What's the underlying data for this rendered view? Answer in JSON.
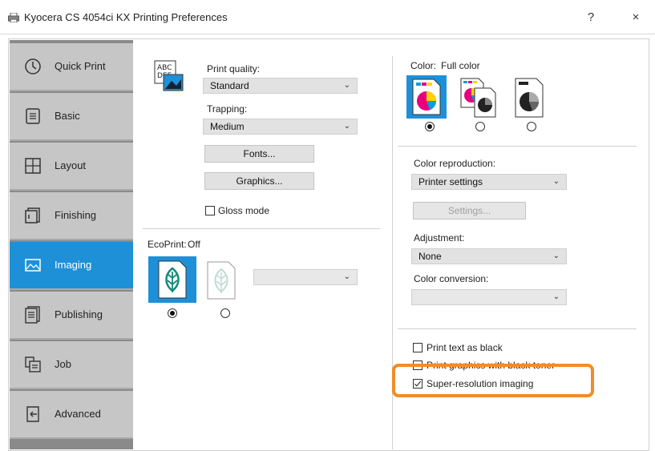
{
  "window": {
    "title": "Kyocera CS 4054ci KX Printing Preferences",
    "help_label": "?",
    "close_label": "×"
  },
  "sidebar": {
    "items": [
      {
        "label": "Quick Print",
        "icon": "clock-icon"
      },
      {
        "label": "Basic",
        "icon": "document-lines-icon"
      },
      {
        "label": "Layout",
        "icon": "grid-layout-icon"
      },
      {
        "label": "Finishing",
        "icon": "finishing-icon"
      },
      {
        "label": "Imaging",
        "icon": "image-icon",
        "active": true
      },
      {
        "label": "Publishing",
        "icon": "publishing-icon"
      },
      {
        "label": "Job",
        "icon": "job-icon"
      },
      {
        "label": "Advanced",
        "icon": "advanced-icon"
      }
    ]
  },
  "imaging": {
    "quality_icon_text_1": "ABC",
    "quality_icon_text_2": "DEF",
    "print_quality_label": "Print quality:",
    "print_quality_value": "Standard",
    "trapping_label": "Trapping:",
    "trapping_value": "Medium",
    "fonts_button": "Fonts...",
    "graphics_button": "Graphics...",
    "gloss_mode_label": "Gloss mode",
    "gloss_mode_checked": false,
    "ecoprint_label": "EcoPrint:",
    "ecoprint_value": "Off",
    "ecoprint_selected_index": 0
  },
  "color": {
    "color_label": "Color:",
    "color_value": "Full color",
    "color_selected_index": 0,
    "color_reproduction_label": "Color reproduction:",
    "color_reproduction_value": "Printer settings",
    "settings_button": "Settings...",
    "adjustment_label": "Adjustment:",
    "adjustment_value": "None",
    "color_conversion_label": "Color conversion:",
    "color_conversion_value": "",
    "print_text_black_label": "Print text as black",
    "print_text_black_checked": false,
    "print_graphics_black_label": "Print graphics with black toner",
    "print_graphics_black_checked": false,
    "super_resolution_label": "Super-resolution imaging",
    "super_resolution_checked": true
  },
  "colors": {
    "accent": "#1e90d8",
    "highlight": "#f28c28",
    "sidebar_item": "#c6c6c6"
  }
}
